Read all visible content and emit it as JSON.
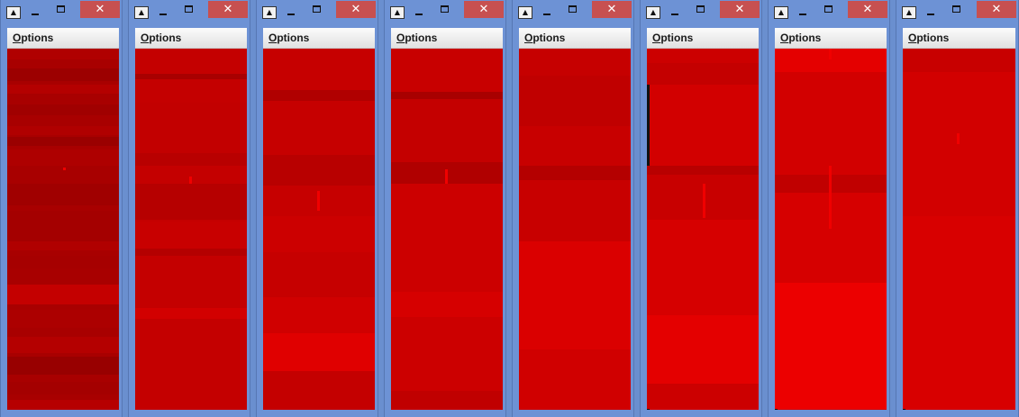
{
  "colors": {
    "window_frame": "#6d92d5",
    "close_button": "#c75050",
    "menubar": "#f0f0f0",
    "canvas_base": "#c80000"
  },
  "icons": {
    "app": "app-icon",
    "minimize": "minimize-icon",
    "maximize": "maximize-icon",
    "close": "close-icon"
  },
  "windows": [
    {
      "menu_label_rest": "ptions",
      "menu_label_mnemonic": "O",
      "close_glyph": "✕",
      "canvas_color": "#a80000"
    },
    {
      "menu_label_rest": "ptions",
      "menu_label_mnemonic": "O",
      "close_glyph": "✕",
      "canvas_color": "#c40000"
    },
    {
      "menu_label_rest": "ptions",
      "menu_label_mnemonic": "O",
      "close_glyph": "✕",
      "canvas_color": "#c60000"
    },
    {
      "menu_label_rest": "ptions",
      "menu_label_mnemonic": "O",
      "close_glyph": "✕",
      "canvas_color": "#c80000"
    },
    {
      "menu_label_rest": "ptions",
      "menu_label_mnemonic": "O",
      "close_glyph": "✕",
      "canvas_color": "#cd0000"
    },
    {
      "menu_label_rest": "ptions",
      "menu_label_mnemonic": "O",
      "close_glyph": "✕",
      "canvas_color": "#d20000"
    },
    {
      "menu_label_rest": "ptions",
      "menu_label_mnemonic": "O",
      "close_glyph": "✕",
      "canvas_color": "#d60000"
    },
    {
      "menu_label_rest": "ptions",
      "menu_label_mnemonic": "O",
      "close_glyph": "✕",
      "canvas_color": "#d40000"
    }
  ]
}
